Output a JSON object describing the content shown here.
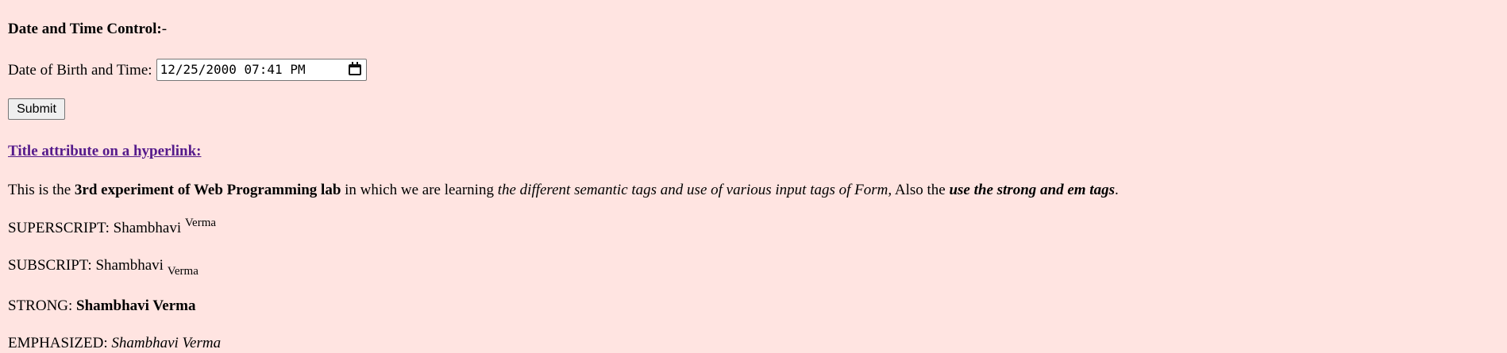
{
  "heading": {
    "label": "Date and Time Control:",
    "suffix": "-"
  },
  "form": {
    "dob_label": "Date of Birth and Time:",
    "dob_value": "12/25/2000 07:41 PM",
    "submit_label": "Submit"
  },
  "link": {
    "text": "Title attribute on a hyperlink:"
  },
  "paragraph": {
    "t1": "This is the ",
    "b1": "3rd experiment of Web Programming lab",
    "t2": " in which we are learning ",
    "i1": "the different semantic tags and use of various input tags of Form,",
    "t3": " Also the ",
    "bi1": "use the strong and em tags",
    "t4": "."
  },
  "superscript": {
    "label": "SUPERSCRIPT: Shambhavi ",
    "sup": "Verma"
  },
  "subscript": {
    "label": "SUBSCRIPT: Shambhavi ",
    "sub": "Verma"
  },
  "strong": {
    "label": "STRONG: ",
    "value": "Shambhavi Verma"
  },
  "emphasized": {
    "label": "EMPHASIZED: ",
    "value": "Shambhavi Verma"
  },
  "icons": {
    "date_picker": "calendar-icon"
  },
  "colors": {
    "background": "#ffe4e1",
    "link": "#551a8b",
    "button": "#efefef"
  }
}
